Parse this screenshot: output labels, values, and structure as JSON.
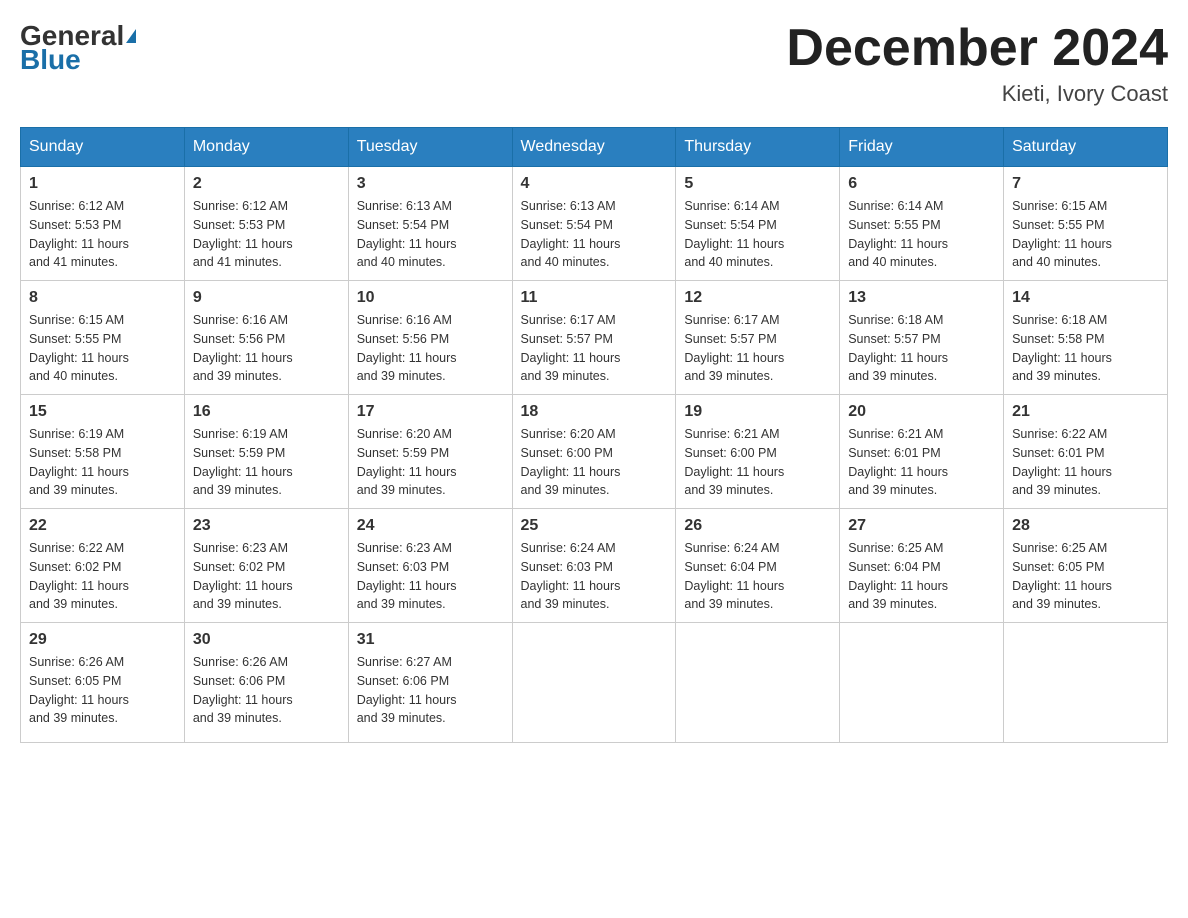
{
  "header": {
    "logo_general": "General",
    "logo_blue": "Blue",
    "month_title": "December 2024",
    "location": "Kieti, Ivory Coast"
  },
  "days_of_week": [
    "Sunday",
    "Monday",
    "Tuesday",
    "Wednesday",
    "Thursday",
    "Friday",
    "Saturday"
  ],
  "weeks": [
    [
      {
        "day": "1",
        "sunrise": "6:12 AM",
        "sunset": "5:53 PM",
        "daylight": "11 hours and 41 minutes."
      },
      {
        "day": "2",
        "sunrise": "6:12 AM",
        "sunset": "5:53 PM",
        "daylight": "11 hours and 41 minutes."
      },
      {
        "day": "3",
        "sunrise": "6:13 AM",
        "sunset": "5:54 PM",
        "daylight": "11 hours and 40 minutes."
      },
      {
        "day": "4",
        "sunrise": "6:13 AM",
        "sunset": "5:54 PM",
        "daylight": "11 hours and 40 minutes."
      },
      {
        "day": "5",
        "sunrise": "6:14 AM",
        "sunset": "5:54 PM",
        "daylight": "11 hours and 40 minutes."
      },
      {
        "day": "6",
        "sunrise": "6:14 AM",
        "sunset": "5:55 PM",
        "daylight": "11 hours and 40 minutes."
      },
      {
        "day": "7",
        "sunrise": "6:15 AM",
        "sunset": "5:55 PM",
        "daylight": "11 hours and 40 minutes."
      }
    ],
    [
      {
        "day": "8",
        "sunrise": "6:15 AM",
        "sunset": "5:55 PM",
        "daylight": "11 hours and 40 minutes."
      },
      {
        "day": "9",
        "sunrise": "6:16 AM",
        "sunset": "5:56 PM",
        "daylight": "11 hours and 39 minutes."
      },
      {
        "day": "10",
        "sunrise": "6:16 AM",
        "sunset": "5:56 PM",
        "daylight": "11 hours and 39 minutes."
      },
      {
        "day": "11",
        "sunrise": "6:17 AM",
        "sunset": "5:57 PM",
        "daylight": "11 hours and 39 minutes."
      },
      {
        "day": "12",
        "sunrise": "6:17 AM",
        "sunset": "5:57 PM",
        "daylight": "11 hours and 39 minutes."
      },
      {
        "day": "13",
        "sunrise": "6:18 AM",
        "sunset": "5:57 PM",
        "daylight": "11 hours and 39 minutes."
      },
      {
        "day": "14",
        "sunrise": "6:18 AM",
        "sunset": "5:58 PM",
        "daylight": "11 hours and 39 minutes."
      }
    ],
    [
      {
        "day": "15",
        "sunrise": "6:19 AM",
        "sunset": "5:58 PM",
        "daylight": "11 hours and 39 minutes."
      },
      {
        "day": "16",
        "sunrise": "6:19 AM",
        "sunset": "5:59 PM",
        "daylight": "11 hours and 39 minutes."
      },
      {
        "day": "17",
        "sunrise": "6:20 AM",
        "sunset": "5:59 PM",
        "daylight": "11 hours and 39 minutes."
      },
      {
        "day": "18",
        "sunrise": "6:20 AM",
        "sunset": "6:00 PM",
        "daylight": "11 hours and 39 minutes."
      },
      {
        "day": "19",
        "sunrise": "6:21 AM",
        "sunset": "6:00 PM",
        "daylight": "11 hours and 39 minutes."
      },
      {
        "day": "20",
        "sunrise": "6:21 AM",
        "sunset": "6:01 PM",
        "daylight": "11 hours and 39 minutes."
      },
      {
        "day": "21",
        "sunrise": "6:22 AM",
        "sunset": "6:01 PM",
        "daylight": "11 hours and 39 minutes."
      }
    ],
    [
      {
        "day": "22",
        "sunrise": "6:22 AM",
        "sunset": "6:02 PM",
        "daylight": "11 hours and 39 minutes."
      },
      {
        "day": "23",
        "sunrise": "6:23 AM",
        "sunset": "6:02 PM",
        "daylight": "11 hours and 39 minutes."
      },
      {
        "day": "24",
        "sunrise": "6:23 AM",
        "sunset": "6:03 PM",
        "daylight": "11 hours and 39 minutes."
      },
      {
        "day": "25",
        "sunrise": "6:24 AM",
        "sunset": "6:03 PM",
        "daylight": "11 hours and 39 minutes."
      },
      {
        "day": "26",
        "sunrise": "6:24 AM",
        "sunset": "6:04 PM",
        "daylight": "11 hours and 39 minutes."
      },
      {
        "day": "27",
        "sunrise": "6:25 AM",
        "sunset": "6:04 PM",
        "daylight": "11 hours and 39 minutes."
      },
      {
        "day": "28",
        "sunrise": "6:25 AM",
        "sunset": "6:05 PM",
        "daylight": "11 hours and 39 minutes."
      }
    ],
    [
      {
        "day": "29",
        "sunrise": "6:26 AM",
        "sunset": "6:05 PM",
        "daylight": "11 hours and 39 minutes."
      },
      {
        "day": "30",
        "sunrise": "6:26 AM",
        "sunset": "6:06 PM",
        "daylight": "11 hours and 39 minutes."
      },
      {
        "day": "31",
        "sunrise": "6:27 AM",
        "sunset": "6:06 PM",
        "daylight": "11 hours and 39 minutes."
      },
      null,
      null,
      null,
      null
    ]
  ],
  "labels": {
    "sunrise": "Sunrise:",
    "sunset": "Sunset:",
    "daylight": "Daylight:"
  }
}
